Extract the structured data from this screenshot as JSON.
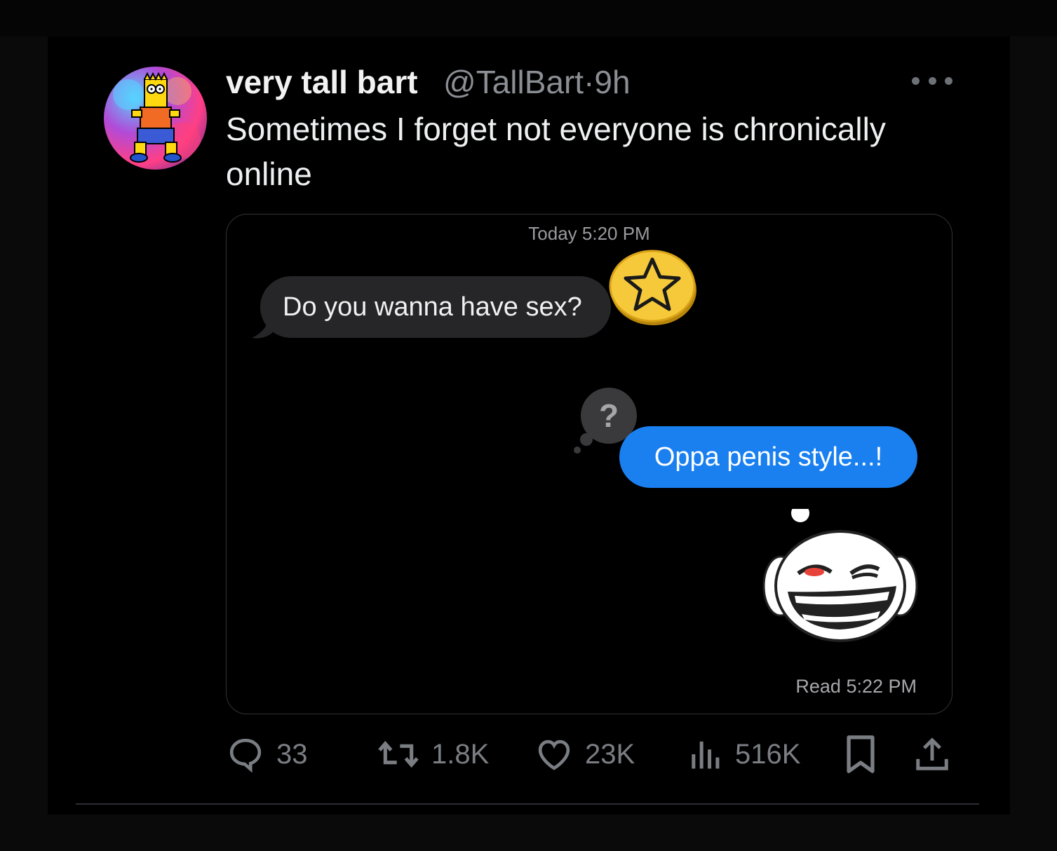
{
  "tweet": {
    "display_name": "very tall bart",
    "handle": "@TallBart",
    "separator": "·",
    "time": "9h",
    "text": "Sometimes I forget not everyone is chronically online"
  },
  "media": {
    "timestamp": "Today 5:20 PM",
    "incoming_message": "Do you wanna have sex?",
    "outgoing_message": "Oppa penis style...!",
    "read_receipt": "Read 5:22 PM",
    "question_mark": "?"
  },
  "actions": {
    "replies": "33",
    "reposts": "1.8K",
    "likes": "23K",
    "views": "516K"
  },
  "colors": {
    "background": "#000000",
    "outgoing_bubble": "#1a80f0",
    "incoming_bubble": "#262628",
    "muted_text": "#7a7e83"
  }
}
